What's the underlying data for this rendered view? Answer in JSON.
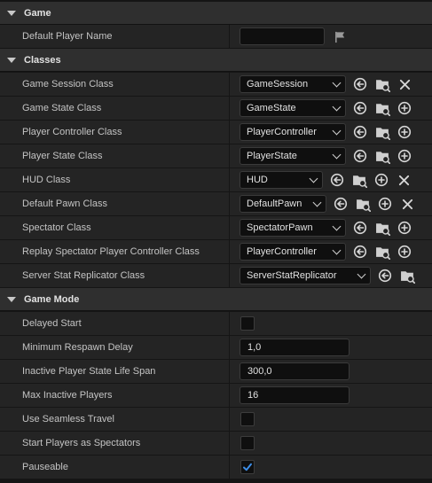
{
  "sections": {
    "game": {
      "title": "Game"
    },
    "classes": {
      "title": "Classes"
    },
    "game_mode": {
      "title": "Game Mode"
    }
  },
  "game": {
    "default_player_name": {
      "label": "Default Player Name",
      "value": ""
    }
  },
  "classes": {
    "game_session": {
      "label": "Game Session Class",
      "value": "GameSession"
    },
    "game_state": {
      "label": "Game State Class",
      "value": "GameState"
    },
    "player_controller": {
      "label": "Player Controller Class",
      "value": "PlayerController"
    },
    "player_state": {
      "label": "Player State Class",
      "value": "PlayerState"
    },
    "hud": {
      "label": "HUD Class",
      "value": "HUD"
    },
    "default_pawn": {
      "label": "Default Pawn Class",
      "value": "DefaultPawn"
    },
    "spectator": {
      "label": "Spectator Class",
      "value": "SpectatorPawn"
    },
    "replay_spectator": {
      "label": "Replay Spectator Player Controller Class",
      "value": "PlayerController"
    },
    "server_stat": {
      "label": "Server Stat Replicator Class",
      "value": "ServerStatReplicator"
    }
  },
  "game_mode": {
    "delayed_start": {
      "label": "Delayed Start",
      "checked": false
    },
    "min_respawn_delay": {
      "label": "Minimum Respawn Delay",
      "value": "1,0"
    },
    "inactive_life_span": {
      "label": "Inactive Player State Life Span",
      "value": "300,0"
    },
    "max_inactive_players": {
      "label": "Max Inactive Players",
      "value": "16"
    },
    "seamless_travel": {
      "label": "Use Seamless Travel",
      "checked": false
    },
    "start_as_spectators": {
      "label": "Start Players as Spectators",
      "checked": false
    },
    "pauseable": {
      "label": "Pauseable",
      "checked": true
    }
  },
  "icons": {
    "flag": "flag-icon",
    "use_selected": "use-selected-arrow-icon",
    "browse": "browse-folder-icon",
    "add": "add-circle-icon",
    "clear": "clear-x-icon"
  },
  "colors": {
    "checkmark": "#3d8ee8",
    "background": "#242424",
    "header": "#2f2f2f"
  }
}
